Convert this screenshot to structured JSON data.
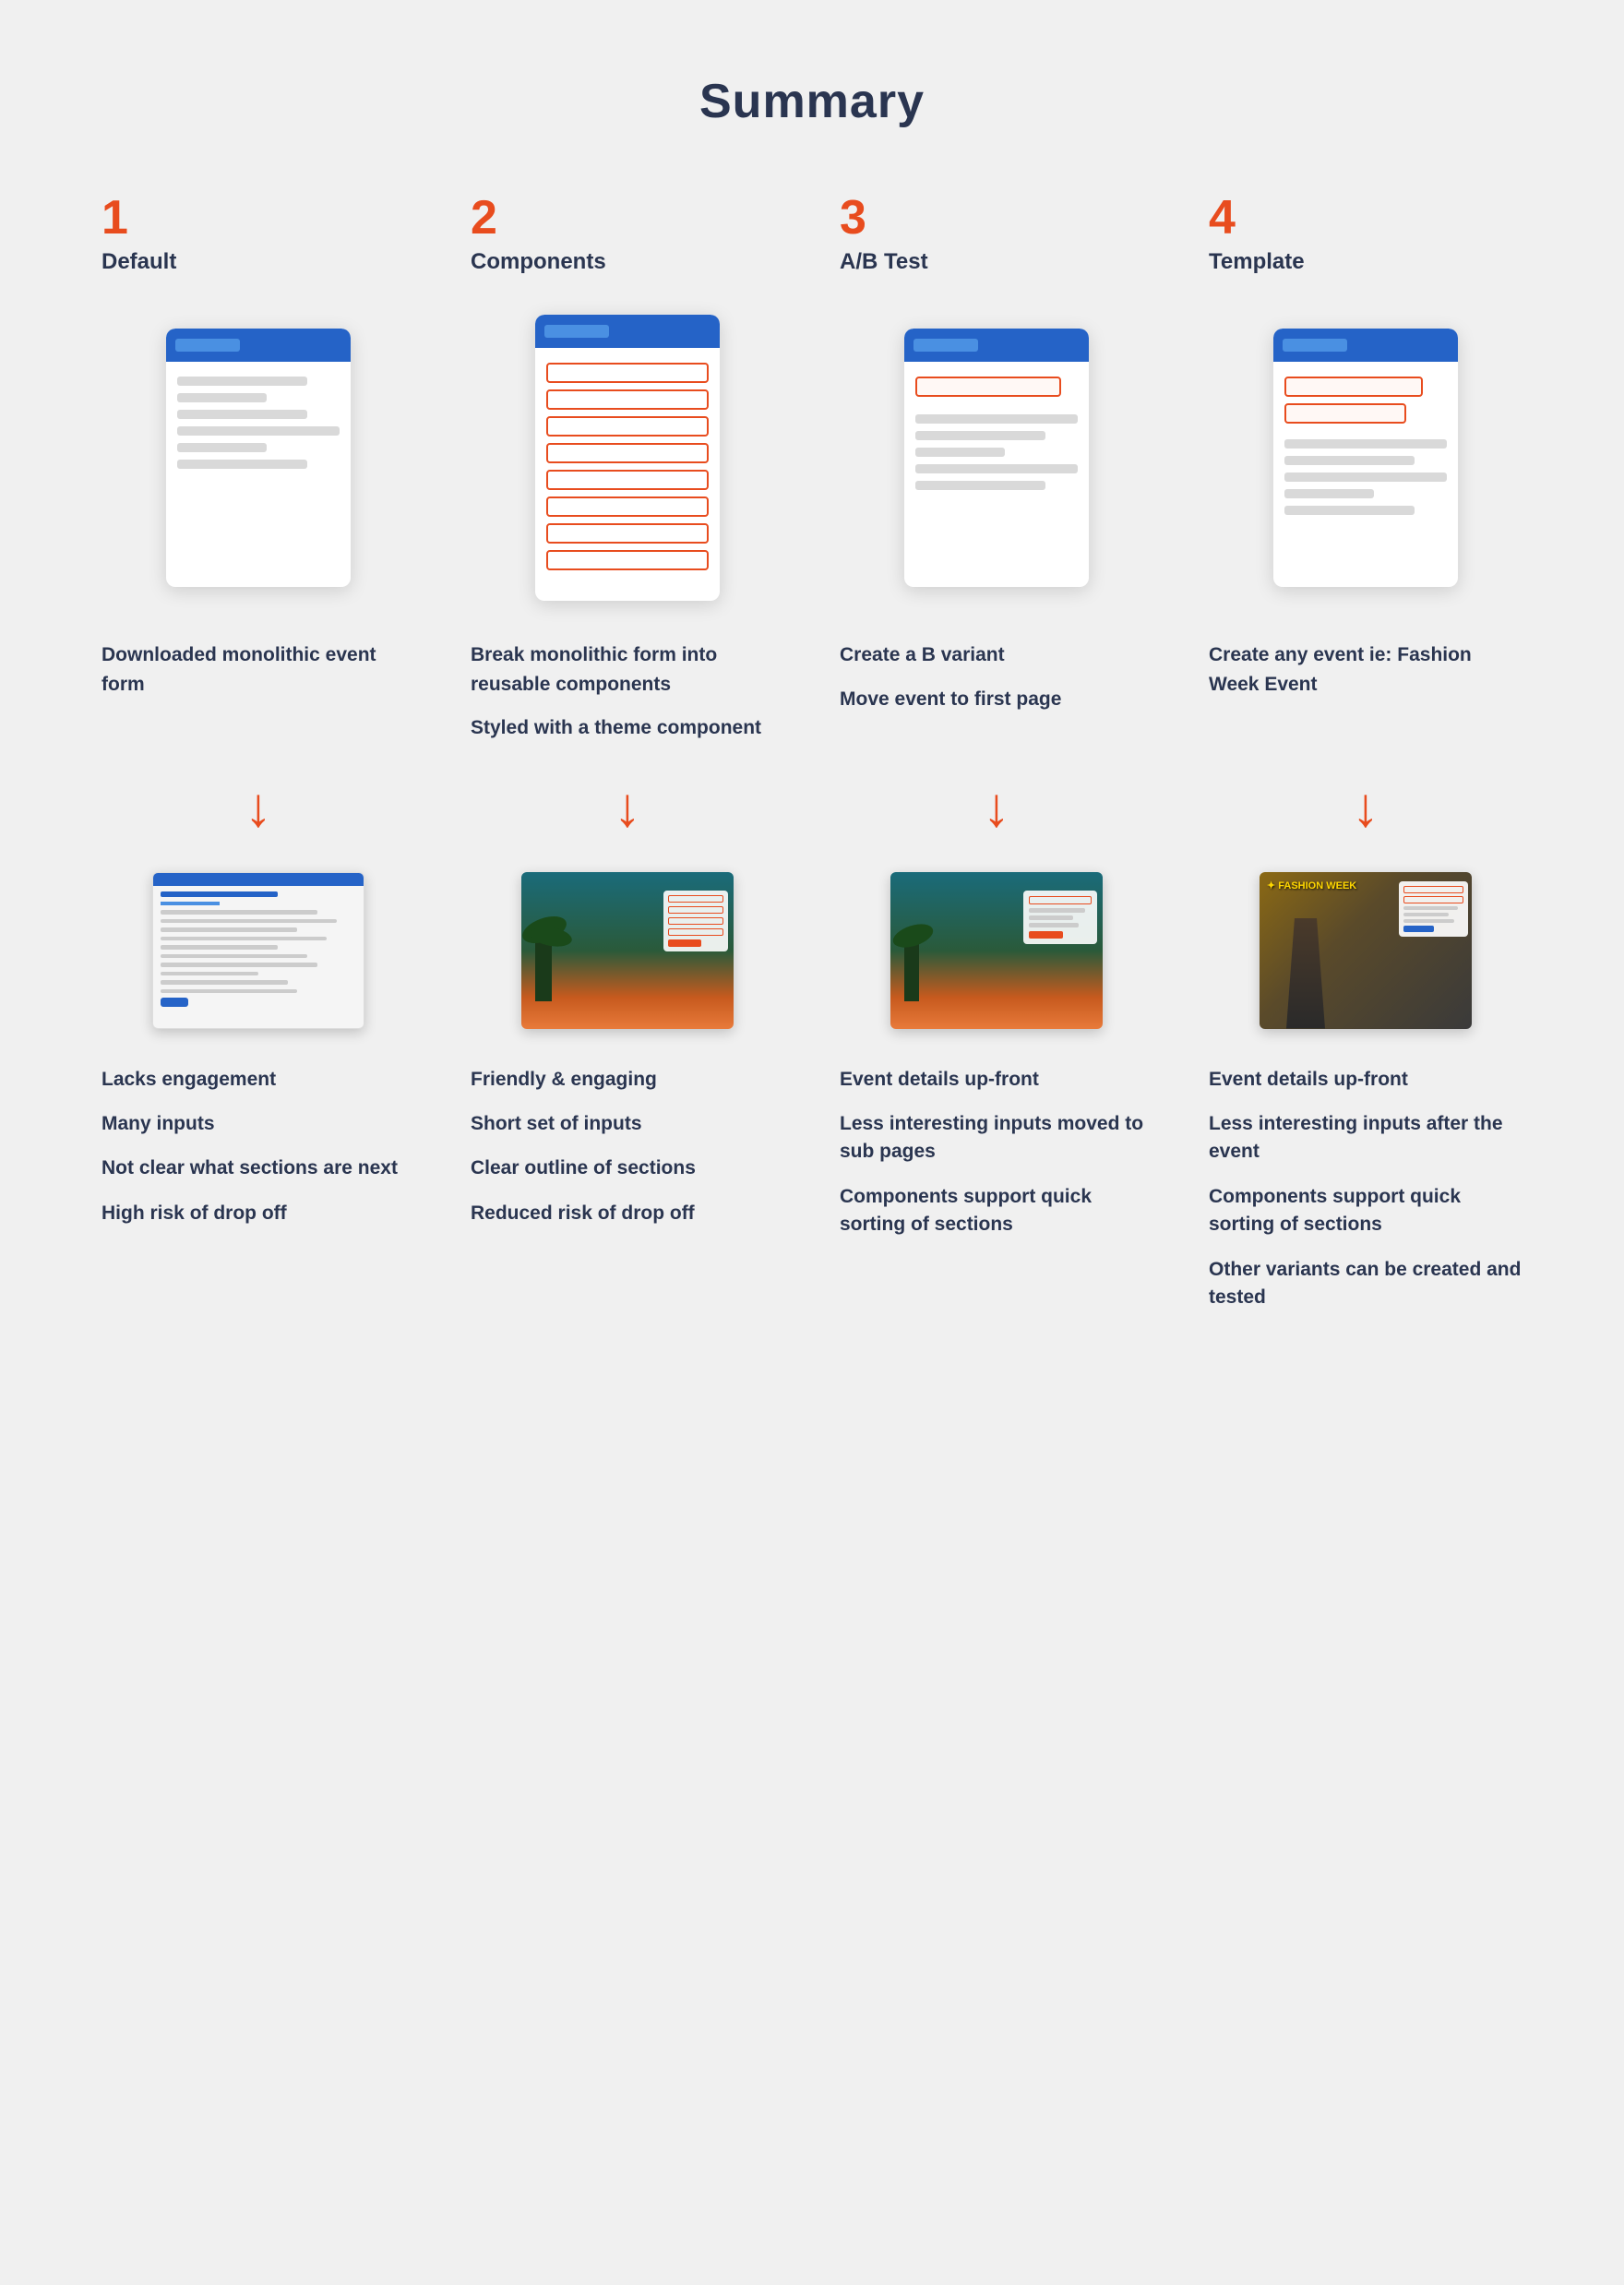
{
  "page": {
    "title": "Summary"
  },
  "columns": [
    {
      "number": "1",
      "label": "Default",
      "desc1": "Downloaded monolithic event form",
      "desc2": null,
      "outcomes": [
        "Lacks engagement",
        "Many inputs",
        "Not clear what sections are next",
        "High risk of drop off"
      ]
    },
    {
      "number": "2",
      "label": "Components",
      "desc1": "Break monolithic form into reusable components",
      "desc2": "Styled with a theme component",
      "outcomes": [
        "Friendly & engaging",
        "Short set of inputs",
        "Clear outline of sections",
        "Reduced risk of drop off"
      ]
    },
    {
      "number": "3",
      "label": "A/B Test",
      "desc1": "Create a B variant",
      "desc2": "Move event to first page",
      "outcomes": [
        "Event details up-front",
        "Less interesting inputs moved to sub pages",
        "Components support quick sorting of sections"
      ]
    },
    {
      "number": "4",
      "label": "Template",
      "desc1": "Create any event ie: Fashion Week Event",
      "desc2": null,
      "outcomes": [
        "Event details up-front",
        "Less interesting inputs after the event",
        "Components support quick sorting of sections",
        "Other variants can be created and tested"
      ]
    }
  ],
  "arrow": "↓"
}
